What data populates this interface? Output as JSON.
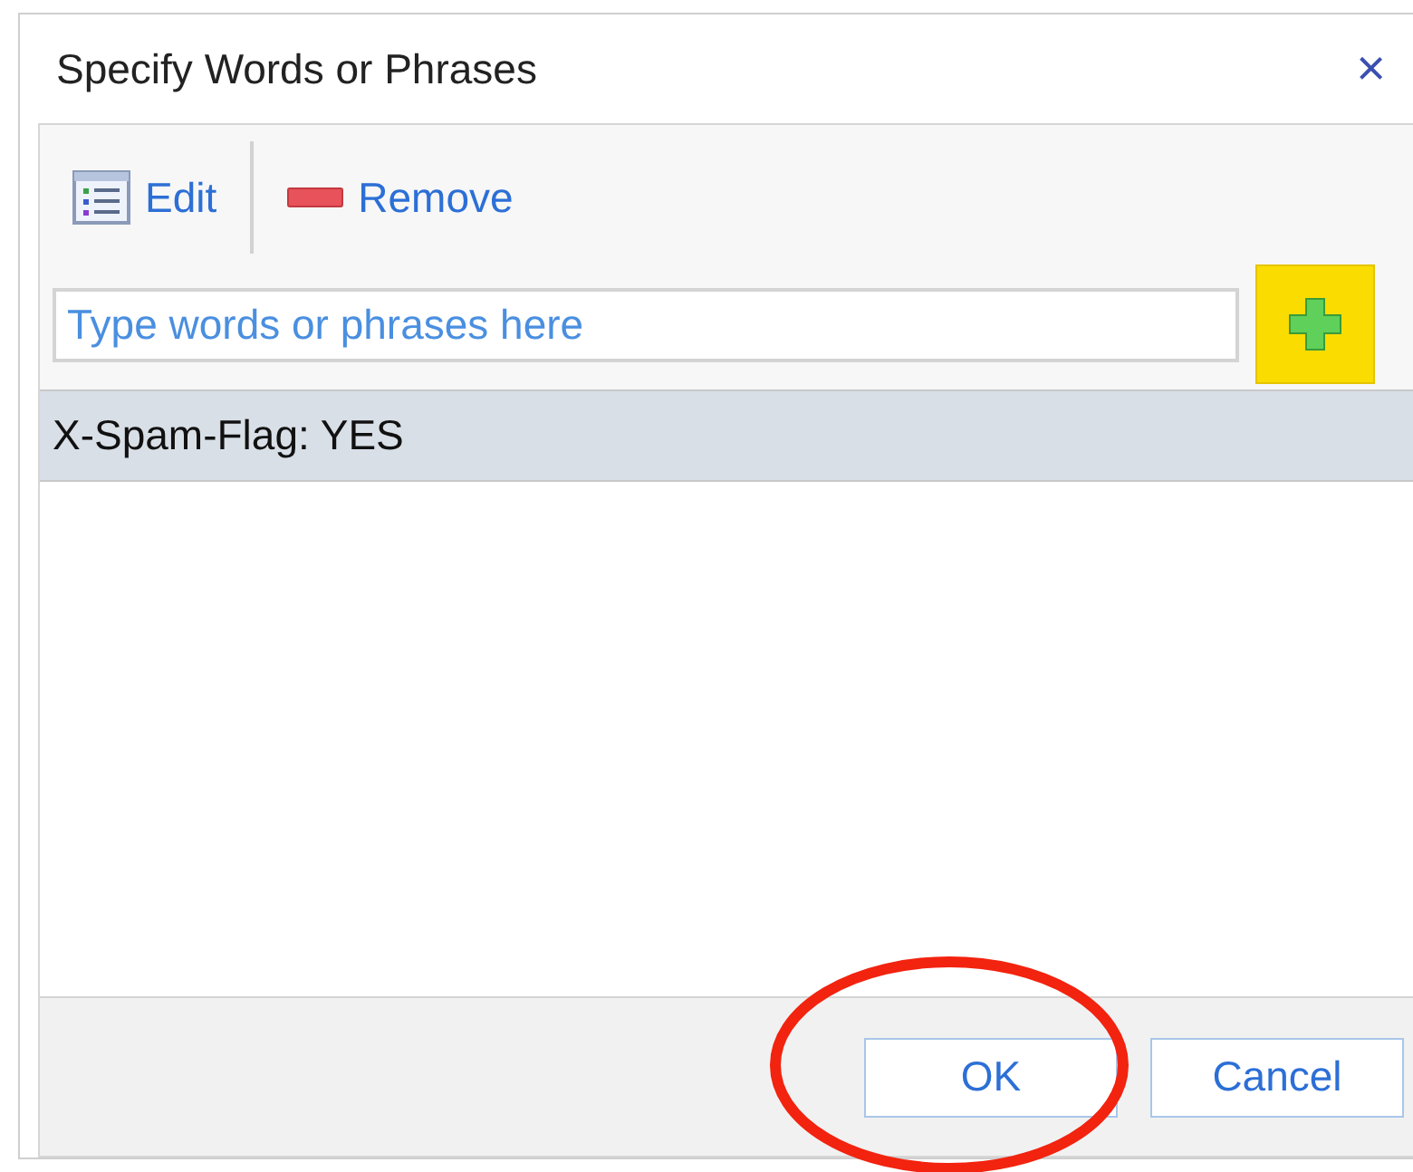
{
  "dialog": {
    "title": "Specify Words or Phrases",
    "close": "×"
  },
  "toolbar": [
    {
      "kind": "edit",
      "label": "Edit"
    },
    {
      "kind": "remove",
      "label": "Remove"
    }
  ],
  "input": {
    "placeholder": "Type words or phrases here"
  },
  "list": [
    {
      "text": "X-Spam-Flag: YES",
      "selected": true
    }
  ],
  "buttons": [
    {
      "label": "OK"
    },
    {
      "label": "Cancel"
    }
  ]
}
